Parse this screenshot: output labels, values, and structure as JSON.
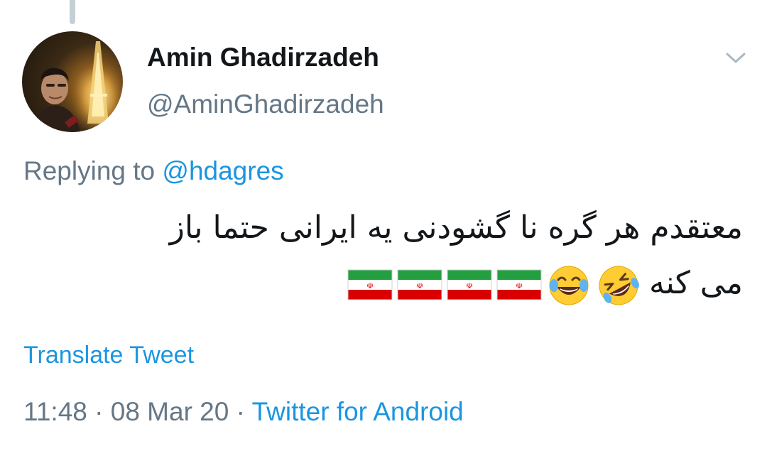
{
  "tweet": {
    "display_name": "Amin Ghadirzadeh",
    "handle": "@AminGhadirzadeh",
    "replying_prefix": "Replying to",
    "replying_to": "@hdagres",
    "text_line_1": "معتقدم هر گره نا گشودنی یه ایرانی حتما باز",
    "text_line_2": "می کنه",
    "emojis": [
      "rolling-on-floor-laughing-emoji",
      "face-with-tears-of-joy-emoji",
      "iran-flag-emoji",
      "iran-flag-emoji",
      "iran-flag-emoji",
      "iran-flag-emoji"
    ],
    "translate_label": "Translate Tweet",
    "time": "11:48",
    "separator": "·",
    "date": "08 Mar 20",
    "source": "Twitter for Android"
  },
  "icons": {
    "menu": "chevron-down-icon"
  },
  "colors": {
    "link": "#1b95e0",
    "secondary_text": "#657786",
    "primary_text": "#14171a",
    "flag_green": "#239f40",
    "flag_red": "#da0000"
  }
}
